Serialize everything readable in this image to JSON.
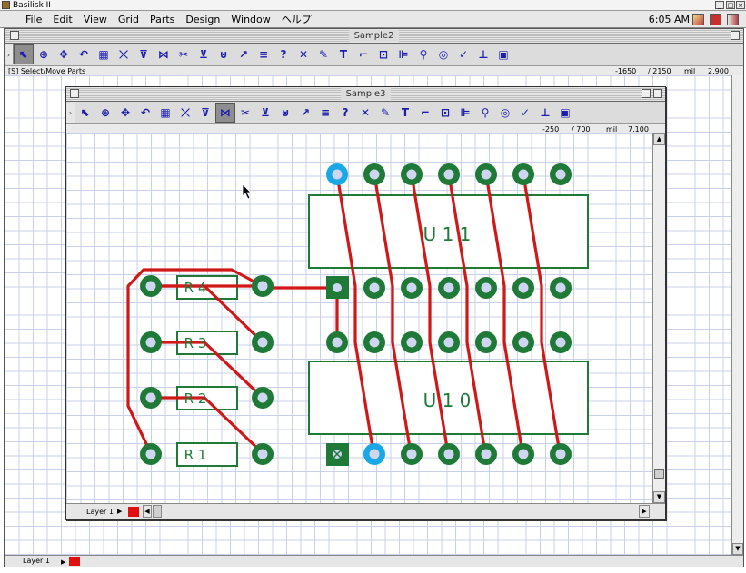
{
  "emulator": {
    "title": "Basilisk II"
  },
  "menubar": {
    "menus": [
      "File",
      "Edit",
      "View",
      "Grid",
      "Parts",
      "Design",
      "Window",
      "ヘルプ"
    ],
    "clock": "6:05 AM"
  },
  "outer_window": {
    "title": "Sample2",
    "status": {
      "left": "[S] Select/Move Parts",
      "x": "-1650",
      "y": "/ 2150",
      "unit": "mil",
      "zoom": "2.900"
    },
    "layer": "Layer 1"
  },
  "inner_window": {
    "title": "Sample3",
    "status": {
      "x": "-250",
      "y": "/ 700",
      "unit": "mil",
      "zoom": "7.100"
    },
    "layer": "Layer 1"
  },
  "toolbar": {
    "icons": [
      "select-arrow-icon",
      "zoom-icon",
      "pan-icon",
      "rotate-icon",
      "place-part-icon",
      "wire-icon",
      "pad-icon",
      "reroute-icon",
      "cut-icon",
      "via-icon",
      "net-icon",
      "arc-icon",
      "bus-icon",
      "question-icon",
      "delete-icon",
      "pencil-icon",
      "text-icon",
      "corner-icon",
      "rect-pad-icon",
      "ruler-icon",
      "probe-icon",
      "target-icon",
      "check-icon",
      "route-icon",
      "chip-icon"
    ],
    "glyphs": [
      "⬉",
      "⊕",
      "✥",
      "↶",
      "▦",
      "⤫",
      "⊽",
      "⋈",
      "✂",
      "⊻",
      "⊍",
      "↗",
      "≡",
      "?",
      "✕",
      "✎",
      "T",
      "⌐",
      "⊡",
      "⊫",
      "⚲",
      "◎",
      "✓",
      "⊥",
      "▣"
    ]
  },
  "pcb": {
    "labels": {
      "u11": "U 1 1",
      "u10": "U 1 0",
      "r4": "R 4",
      "r3": "R 3",
      "r2": "R 2",
      "r1": "R 1"
    },
    "colors": {
      "trace": "#d01818",
      "pad": "#1f7a38",
      "pad_hole": "#cfd6f2",
      "pad_selected": "#1aa7e6",
      "outline": "#1f7a38",
      "grid": "#c9d1ea"
    }
  }
}
